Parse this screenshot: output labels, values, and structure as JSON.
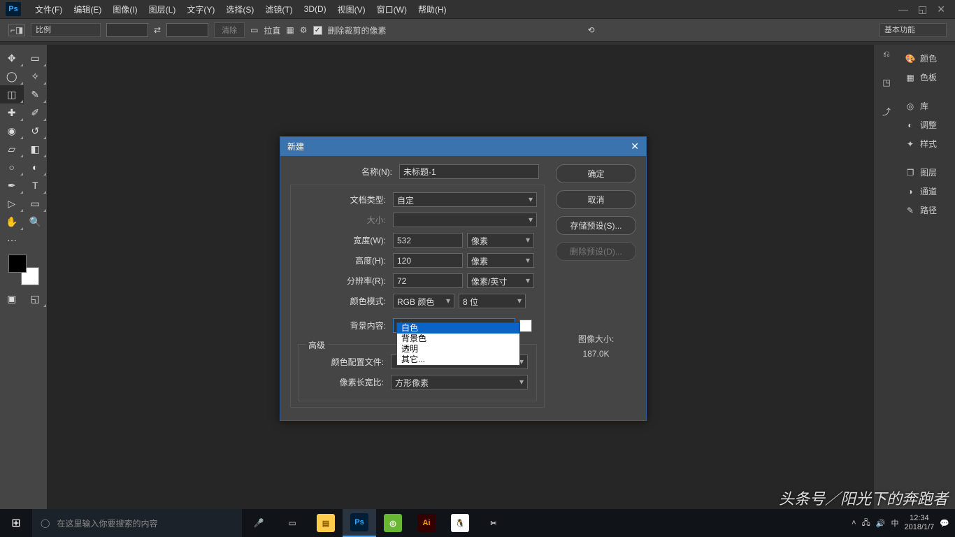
{
  "menubar": {
    "logo": "Ps",
    "items": [
      "文件(F)",
      "编辑(E)",
      "图像(I)",
      "图层(L)",
      "文字(Y)",
      "选择(S)",
      "滤镜(T)",
      "3D(D)",
      "视图(V)",
      "窗口(W)",
      "帮助(H)"
    ]
  },
  "optionsbar": {
    "ratio": "比例",
    "clear": "清除",
    "straighten": "拉直",
    "delete_crop": "删除裁剪的像素",
    "workspace": "基本功能"
  },
  "right_panels": [
    "颜色",
    "色板",
    "库",
    "调整",
    "样式",
    "图层",
    "通道",
    "路径"
  ],
  "dialog": {
    "title": "新建",
    "name_label": "名称(N):",
    "name_value": "未标题-1",
    "doctype_label": "文档类型:",
    "doctype_value": "自定",
    "size_label": "大小:",
    "width_label": "宽度(W):",
    "width_value": "532",
    "width_unit": "像素",
    "height_label": "高度(H):",
    "height_value": "120",
    "height_unit": "像素",
    "res_label": "分辨率(R):",
    "res_value": "72",
    "res_unit": "像素/英寸",
    "colormode_label": "颜色模式:",
    "colormode_value": "RGB 颜色",
    "colordepth_value": "8 位",
    "bg_label": "背景内容:",
    "bg_value": "白色",
    "bg_options": [
      "白色",
      "背景色",
      "透明",
      "其它..."
    ],
    "advanced": "高级",
    "profile_label": "颜色配置文件:",
    "pixelratio_label": "像素长宽比:",
    "pixelratio_value": "方形像素",
    "ok": "确定",
    "cancel": "取消",
    "save_preset": "存储预设(S)...",
    "delete_preset": "删除预设(D)...",
    "imgsize_label": "图像大小:",
    "imgsize_value": "187.0K"
  },
  "taskbar": {
    "search_placeholder": "在这里输入你要搜索的内容",
    "time": "12:34",
    "date": "2018/1/7"
  },
  "watermark": "头条号／阳光下的奔跑者"
}
